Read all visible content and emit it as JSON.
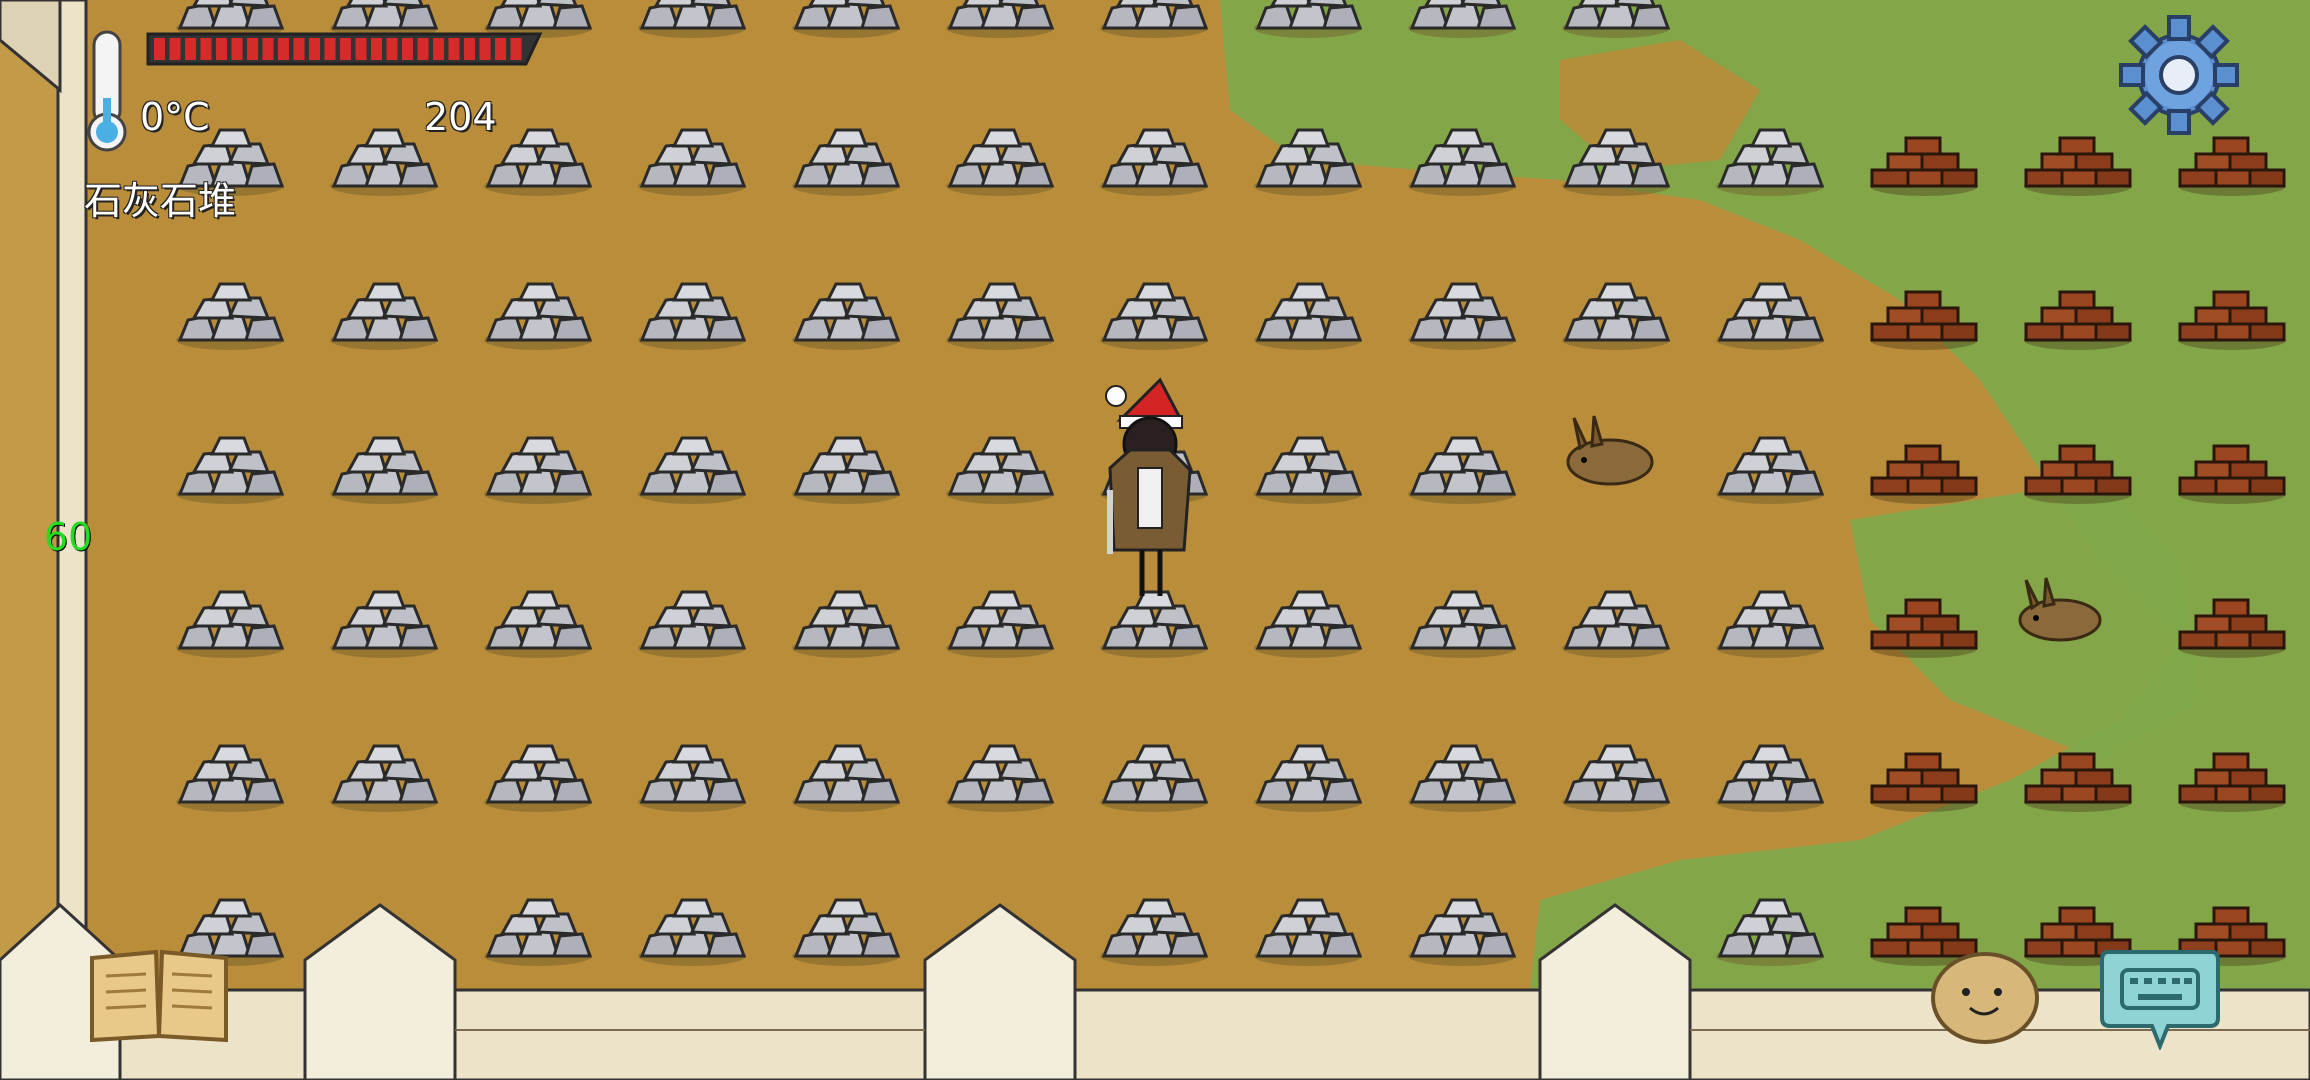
{
  "hud": {
    "temperature": "0°C",
    "item_count": "204",
    "selected_object": "石灰石堆",
    "fps": "60",
    "health_segments": 24
  },
  "colors": {
    "ground": "#b98d3a",
    "grass": "#7fa84a",
    "stone": "#a9abb3",
    "brick": "#8a3b1c",
    "wall": "#ece3c8",
    "health": "#d72b2b",
    "fps": "#22dd22"
  },
  "icons": [
    "thermometer-icon",
    "settings-gear-icon",
    "recipe-book-icon",
    "emote-face-icon",
    "keyboard-icon"
  ]
}
